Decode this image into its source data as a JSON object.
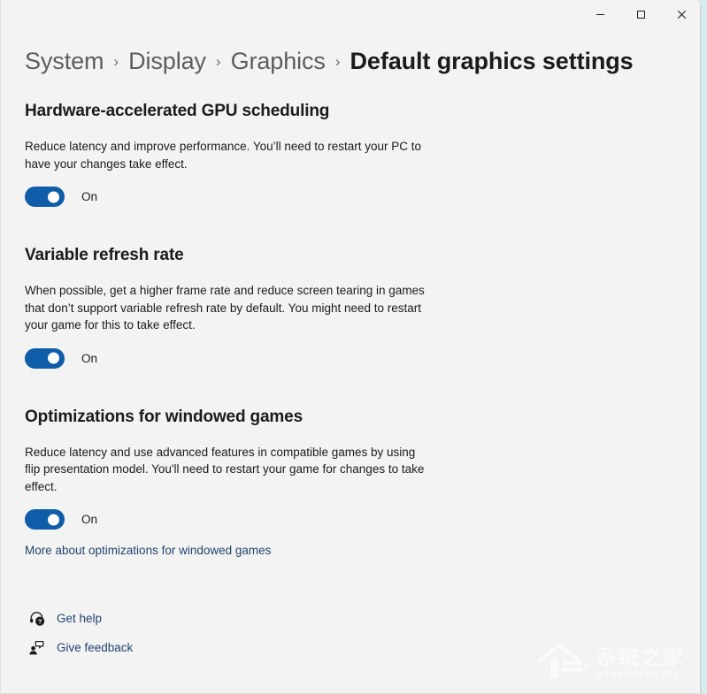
{
  "window": {
    "caption_buttons": [
      {
        "name": "minimize",
        "glyph": "minimize-icon",
        "tooltip": "Minimize"
      },
      {
        "name": "maximize",
        "glyph": "maximize-icon",
        "tooltip": "Maximize"
      },
      {
        "name": "close",
        "glyph": "close-icon",
        "tooltip": "Close"
      }
    ]
  },
  "breadcrumb": {
    "separator": "›",
    "items": [
      {
        "label": "System",
        "current": false
      },
      {
        "label": "Display",
        "current": false
      },
      {
        "label": "Graphics",
        "current": false
      },
      {
        "label": "Default graphics settings",
        "current": true
      }
    ]
  },
  "sections": [
    {
      "id": "gpu-scheduling",
      "title": "Hardware-accelerated GPU scheduling",
      "description": "Reduce latency and improve performance. You’ll need to restart your PC to have your changes take effect.",
      "toggle_state": "On",
      "toggle_on": true
    },
    {
      "id": "variable-refresh",
      "title": "Variable refresh rate",
      "description": "When possible, get a higher frame rate and reduce screen tearing in games that don’t support variable refresh rate by default. You might need to restart your game for this to take effect.",
      "toggle_state": "On",
      "toggle_on": true
    },
    {
      "id": "windowed-optimizations",
      "title": "Optimizations for windowed games",
      "description": "Reduce latency and use advanced features in compatible games by using flip presentation model. You'll need to restart your game for changes to take effect.",
      "toggle_state": "On",
      "toggle_on": true,
      "link_label": "More about optimizations for windowed games"
    }
  ],
  "footer": {
    "links": [
      {
        "label": "Get help",
        "icon": "help-headset-icon"
      },
      {
        "label": "Give feedback",
        "icon": "feedback-person-icon"
      }
    ]
  },
  "watermark": {
    "chinese": "系统之家",
    "english": "XITONGZHIJIA.NET"
  },
  "colors": {
    "accent_toggle": "#0f5ca8",
    "link": "#21446e",
    "page_background": "#f3f3f3",
    "desktop_background": "#d8eced",
    "text_primary": "#1b1b1b",
    "text_secondary": "#5d5d5d"
  }
}
